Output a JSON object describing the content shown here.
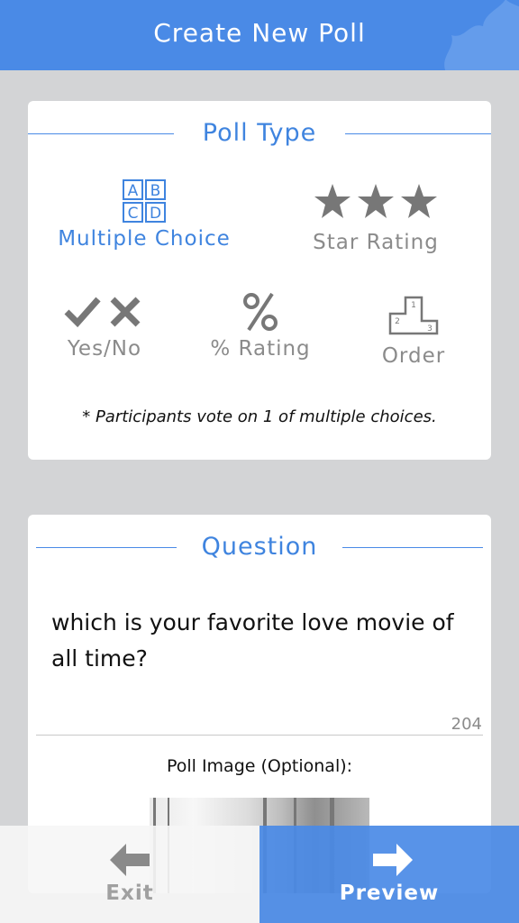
{
  "header": {
    "title": "Create New Poll"
  },
  "poll_type": {
    "section_title": "Poll Type",
    "types": [
      {
        "label": "Multiple Choice",
        "icon": "abcd-grid-icon",
        "selected": true
      },
      {
        "label": "Star Rating",
        "icon": "three-stars-icon",
        "selected": false
      },
      {
        "label": "Yes/No",
        "icon": "check-cross-icon",
        "selected": false
      },
      {
        "label": "% Rating",
        "icon": "percent-icon",
        "selected": false
      },
      {
        "label": "Order",
        "icon": "podium-icon",
        "selected": false
      }
    ],
    "abcd": [
      "A",
      "B",
      "C",
      "D"
    ],
    "podium_numbers": [
      "1",
      "2",
      "3"
    ],
    "note": "* Participants vote on 1 of multiple choices."
  },
  "question": {
    "section_title": "Question",
    "text": "which is your favorite love movie of all time?",
    "char_count": "204",
    "image_label": "Poll Image (Optional):"
  },
  "bottom_bar": {
    "exit_label": "Exit",
    "preview_label": "Preview"
  },
  "colors": {
    "accent": "#4a8ae6",
    "background": "#d3d4d6",
    "muted": "#8b8b8b"
  }
}
